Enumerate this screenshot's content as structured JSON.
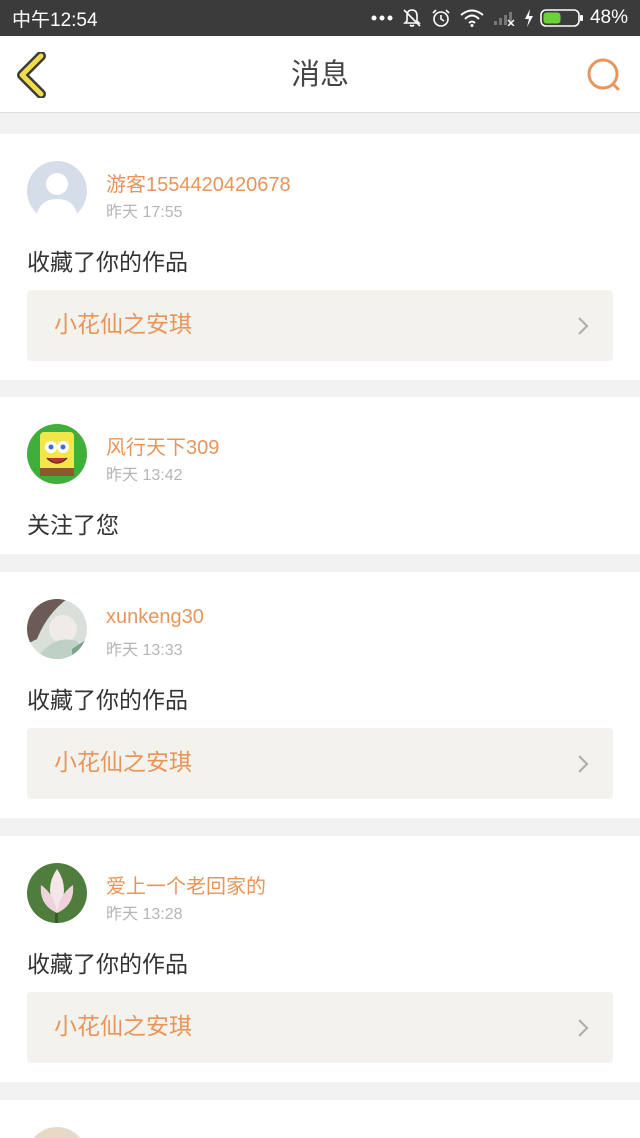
{
  "status_bar": {
    "time": "中午12:54",
    "battery": "48%",
    "icons": [
      "more-dots-icon",
      "bell-muted-icon",
      "alarm-icon",
      "wifi-icon",
      "signal-icon",
      "charging-icon",
      "battery-icon"
    ]
  },
  "header": {
    "title": "消息",
    "back_icon": "chevron-left-icon",
    "search_icon": "search-icon"
  },
  "colors": {
    "accent": "#e8955b",
    "back_icon_fill": "#f1dd4b",
    "header_bg": "#ffffff",
    "status_bar_bg": "#3b3b3b",
    "page_bg": "#f2f2f2",
    "work_box_bg": "#f3f2ec"
  },
  "messages": [
    {
      "username": "游客1554420420678",
      "time": "昨天 17:55",
      "action": "收藏了你的作品",
      "work_title": "小花仙之安琪",
      "avatar": "default-user-avatar"
    },
    {
      "username": "风行天下309",
      "time": "昨天 13:42",
      "action": "关注了您",
      "avatar": "spongebob-avatar"
    },
    {
      "username": "xunkeng30",
      "time": "昨天 13:33",
      "action": "收藏了你的作品",
      "work_title": "小花仙之安琪",
      "avatar": "photo-avatar"
    },
    {
      "username": "爱上一个老回家的",
      "time": "昨天 13:28",
      "action": "收藏了你的作品",
      "work_title": "小花仙之安琪",
      "avatar": "lotus-avatar"
    }
  ]
}
